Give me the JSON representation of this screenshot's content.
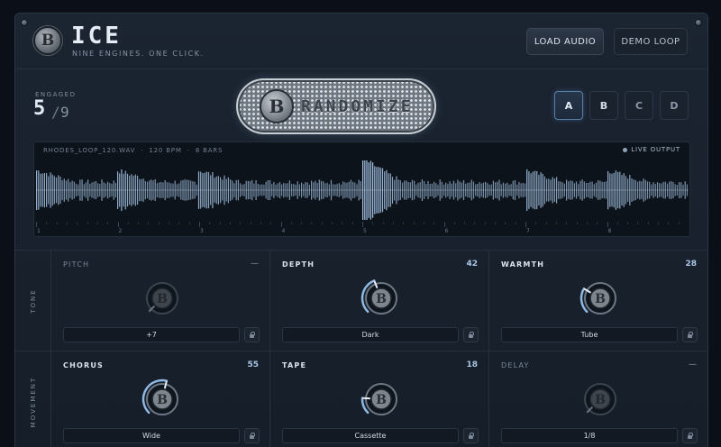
{
  "app": {
    "logo_letter": "B",
    "title": "ICE",
    "subtitle": "NINE ENGINES. ONE CLICK.",
    "load_audio_label": "LOAD AUDIO",
    "demo_loop_label": "DEMO LOOP"
  },
  "engaged": {
    "label": "ENGAGED",
    "count": "5",
    "separator": "/",
    "total": "9"
  },
  "randomize": {
    "label": "RANDOMIZE",
    "logo_letter": "B"
  },
  "slots": [
    {
      "label": "A",
      "active": true
    },
    {
      "label": "B",
      "active": false
    },
    {
      "label": "C",
      "active": false
    },
    {
      "label": "D",
      "active": false
    }
  ],
  "waveform": {
    "file": "RHODES_LOOP_120.WAV",
    "sep1": "·",
    "bpm": "120 BPM",
    "sep2": "·",
    "bars": "8 BARS",
    "live_label": "LIVE OUTPUT",
    "ruler": [
      "1",
      "2",
      "3",
      "4",
      "5",
      "6",
      "7",
      "8"
    ]
  },
  "sections": {
    "tone": {
      "label": "TONE",
      "modules": [
        {
          "name": "PITCH",
          "value": "—",
          "enabled": false,
          "amount": 0,
          "option": "+7"
        },
        {
          "name": "DEPTH",
          "value": "42",
          "enabled": true,
          "amount": 0.42,
          "option": "Dark"
        },
        {
          "name": "WARMTH",
          "value": "28",
          "enabled": true,
          "amount": 0.28,
          "option": "Tube"
        }
      ]
    },
    "movement": {
      "label": "MOVEMENT",
      "modules": [
        {
          "name": "CHORUS",
          "value": "55",
          "enabled": true,
          "amount": 0.55,
          "option": "Wide"
        },
        {
          "name": "TAPE",
          "value": "18",
          "enabled": true,
          "amount": 0.18,
          "option": "Cassette"
        },
        {
          "name": "DELAY",
          "value": "—",
          "enabled": false,
          "amount": 0,
          "option": "1/8"
        }
      ]
    }
  },
  "colors": {
    "accent": "#8fb9e3",
    "panel": "#1b2431",
    "wave": "#a9c9ea"
  },
  "icons": {
    "lock": "lock-icon",
    "live": "live-dot-icon",
    "screw": "screw-icon"
  }
}
